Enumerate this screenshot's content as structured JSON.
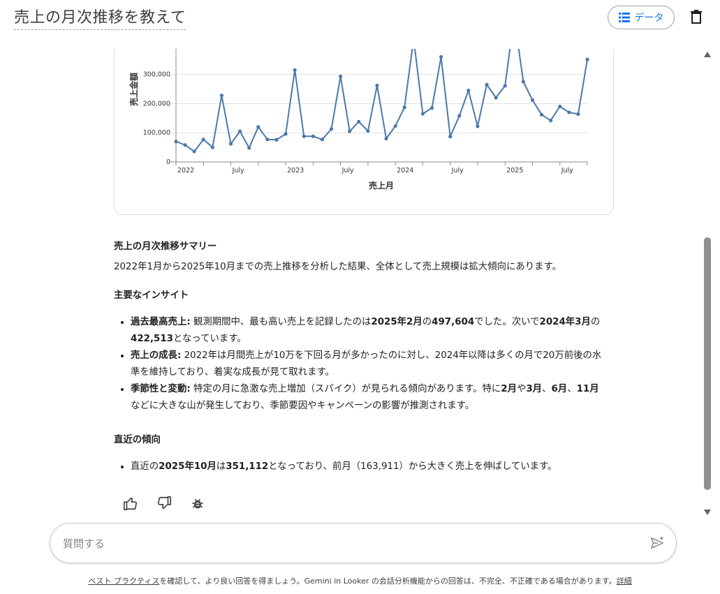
{
  "header": {
    "title": "売上の月次推移を教えて",
    "data_button_label": "データ"
  },
  "chart_data": {
    "type": "line",
    "xlabel": "売上月",
    "ylabel": "売上金額",
    "ylim": [
      0,
      380000
    ],
    "y_ticks": [
      "0",
      "100,000",
      "200,000",
      "300,000"
    ],
    "x_tick_labels": [
      "2022",
      "July",
      "2023",
      "July",
      "2024",
      "July",
      "2025",
      "July"
    ],
    "grid": "horizontal",
    "x": [
      "2022-01",
      "2022-02",
      "2022-03",
      "2022-04",
      "2022-05",
      "2022-06",
      "2022-07",
      "2022-08",
      "2022-09",
      "2022-10",
      "2022-11",
      "2022-12",
      "2023-01",
      "2023-02",
      "2023-03",
      "2023-04",
      "2023-05",
      "2023-06",
      "2023-07",
      "2023-08",
      "2023-09",
      "2023-10",
      "2023-11",
      "2023-12",
      "2024-01",
      "2024-02",
      "2024-03",
      "2024-04",
      "2024-05",
      "2024-06",
      "2024-07",
      "2024-08",
      "2024-09",
      "2024-10",
      "2024-11",
      "2024-12",
      "2025-01",
      "2025-02",
      "2025-03",
      "2025-04",
      "2025-05",
      "2025-06",
      "2025-07",
      "2025-08",
      "2025-09",
      "2025-10"
    ],
    "values": [
      70000,
      58000,
      36000,
      77000,
      50000,
      228000,
      62000,
      105000,
      48000,
      120000,
      77000,
      76000,
      96000,
      315000,
      88000,
      88000,
      77000,
      113000,
      293000,
      105000,
      138000,
      106000,
      262000,
      80000,
      123000,
      187000,
      422513,
      165000,
      185000,
      360000,
      87000,
      158000,
      245000,
      122000,
      265000,
      220000,
      261000,
      497604,
      275000,
      212000,
      162000,
      142000,
      190000,
      170000,
      163911,
      351112
    ],
    "color": "#4c78a8"
  },
  "summary": {
    "title": "売上の月次推移サマリー",
    "intro": "2022年1月から2025年10月までの売上推移を分析した結果、全体として売上規模は拡大傾向にあります。",
    "insights_heading": "主要なインサイト",
    "b1_label": "過去最高売上:",
    "b1_t1": " 観測期間中、最も高い売上を記録したのは",
    "b1_b1": "2025年2月",
    "b1_t2": "の",
    "b1_b2": "497,604",
    "b1_t3": "でした。次いで",
    "b1_b3": "2024年3月",
    "b1_t4": "の",
    "b1_b4": "422,513",
    "b1_t5": "となっています。",
    "b2_label": "売上の成長:",
    "b2_text": " 2022年は月間売上が10万を下回る月が多かったのに対し、2024年以降は多くの月で20万前後の水準を維持しており、着実な成長が見て取れます。",
    "b3_label": "季節性と変動:",
    "b3_t1": " 特定の月に急激な売上増加（スパイク）が見られる傾向があります。特に",
    "b3_b1": "2月",
    "b3_t2": "や",
    "b3_b2": "3月",
    "b3_t3": "、",
    "b3_b3": "6月",
    "b3_t4": "、",
    "b3_b4": "11月",
    "b3_t5": "などに大きな山が発生しており、季節要因やキャンペーンの影響が推測されます。",
    "recent_heading": "直近の傾向",
    "r1_t1": "直近の",
    "r1_b1": "2025年10月",
    "r1_t2": "は",
    "r1_b2": "351,112",
    "r1_t3": "となっており、前月（163,911）から大きく売上を伸ばしています。"
  },
  "feedback": {
    "thumbs_up_icon": "thumbs-up-icon",
    "thumbs_down_icon": "thumbs-down-icon",
    "bug_icon": "bug-icon"
  },
  "input": {
    "placeholder": "質問する",
    "value": ""
  },
  "footer": {
    "link_best_practices": "ベスト プラクティス",
    "text": "を確認して、より良い回答を得ましょう。Gemini in Looker の会話分析機能からの回答は、不完全、不正確である場合があります。",
    "link_details": "詳細"
  },
  "colors": {
    "accent": "#1a73e8",
    "line": "#4c78a8"
  }
}
